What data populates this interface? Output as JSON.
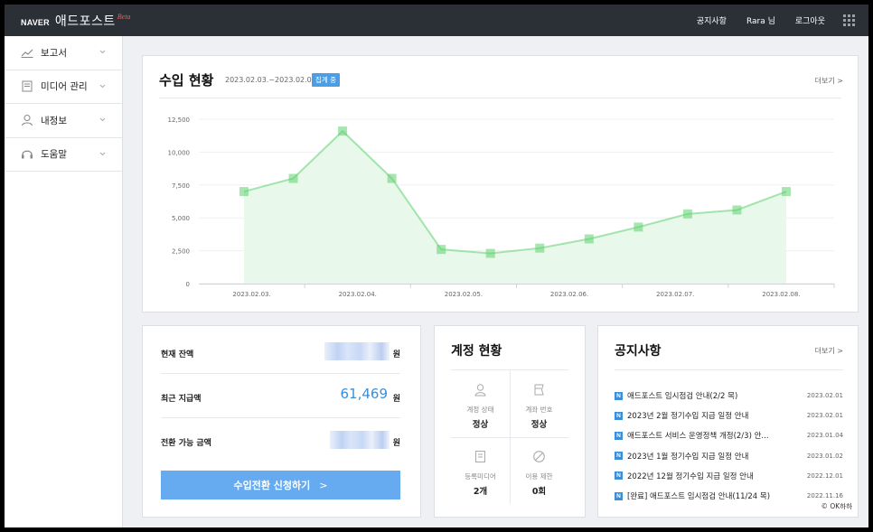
{
  "topbar": {
    "brand": "NAVER",
    "product": "애드포스트",
    "beta": "Beta",
    "links": [
      "공지사항",
      "Rara 님",
      "로그아웃"
    ],
    "apps_icon": "grid-icon"
  },
  "sidebar": {
    "items": [
      {
        "label": "보고서",
        "icon": "chart-icon"
      },
      {
        "label": "미디어 관리",
        "icon": "media-icon"
      },
      {
        "label": "내정보",
        "icon": "user-icon"
      },
      {
        "label": "도움말",
        "icon": "headset-icon"
      }
    ]
  },
  "revenue": {
    "title": "수입 현황",
    "range": "2023.02.03.~2023.02.09.",
    "badge": "집계 중",
    "more": "더보기 >"
  },
  "chart_data": {
    "type": "area",
    "x": [
      "2023.02.03.",
      "2023.02.04.",
      "2023.02.05.",
      "2023.02.06.",
      "2023.02.07.",
      "2023.02.08."
    ],
    "yticks": [
      "12,500",
      "10,000",
      "7,500",
      "5,000",
      "2,500",
      "0"
    ],
    "ylim": [
      0,
      12500
    ],
    "series": [
      {
        "values": [
          7000,
          8000,
          11600,
          8000,
          2600,
          2300,
          2700,
          3400,
          4300,
          5300,
          5600,
          7000
        ]
      }
    ],
    "colors": {
      "line": "#5fd16f",
      "fill": "#e8f8ea"
    }
  },
  "balance": {
    "rows": [
      {
        "label": "현재 잔액",
        "value": "",
        "unit": "원"
      },
      {
        "label": "최근 지급액",
        "value": "61,469",
        "unit": "원"
      },
      {
        "label": "전환 가능 금액",
        "value": "",
        "unit": "원"
      }
    ],
    "cta": "수입전환 신청하기",
    "cta_arrow": ">"
  },
  "account": {
    "title": "계정 현황",
    "cells": [
      {
        "label": "계정 상태",
        "value": "정상",
        "icon": "person-icon"
      },
      {
        "label": "계좌 번호",
        "value": "정상",
        "icon": "bank-card-icon"
      },
      {
        "label": "등록미디어",
        "value": "2개",
        "icon": "document-icon"
      },
      {
        "label": "이용 제한",
        "value": "0회",
        "icon": "prohibited-icon"
      }
    ]
  },
  "notice": {
    "title": "공지사항",
    "more": "더보기 >",
    "badge": "N",
    "items": [
      {
        "title": "애드포스트 임시점검 안내(2/2 목)",
        "date": "2023.02.01"
      },
      {
        "title": "2023년 2월 정기수입 지급 일정 안내",
        "date": "2023.02.01"
      },
      {
        "title": "애드포스트 서비스 운영정책 개정(2/3) 안...",
        "date": "2023.01.04"
      },
      {
        "title": "2023년 1월 정기수입 지급 일정 안내",
        "date": "2023.01.02"
      },
      {
        "title": "2022년 12월 정기수입 지급 일정 안내",
        "date": "2022.12.01"
      },
      {
        "title": "[완료] 애드포스트 임시점검 안내(11/24 목)",
        "date": "2022.11.16"
      }
    ]
  },
  "watermark": "© OK하하"
}
